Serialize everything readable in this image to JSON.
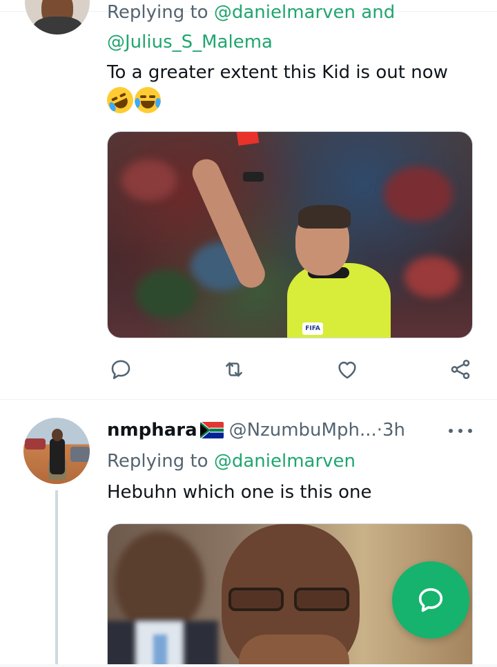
{
  "tweet1": {
    "replying_prefix": "Replying to ",
    "reply_mention_1": "@danielmarven",
    "reply_and": " and",
    "reply_mention_2": "@Julius_S_Malema",
    "text": "To a greater extent this Kid is out now",
    "emojis": [
      "rolling-on-floor-laughing",
      "face-with-tears-of-joy"
    ],
    "media": {
      "alt": "Referee holding up a red card",
      "badge_text": "FIFA"
    },
    "actions": [
      "reply-icon",
      "retweet-icon",
      "like-icon",
      "share-icon"
    ]
  },
  "tweet2": {
    "display_name": "nmphara",
    "flag": "south-africa-flag",
    "handle": "@NzumbuMph...",
    "separator": " · ",
    "time": "3h",
    "replying_prefix": "Replying to ",
    "reply_mention": "@danielmarven",
    "text": "Hebuhn which one is this one"
  },
  "fab": {
    "icon": "compose-reply-icon"
  },
  "colors": {
    "accent": "#1fa66e",
    "fab": "#16b36e",
    "secondary_text": "#536471",
    "primary_text": "#0f1419"
  }
}
